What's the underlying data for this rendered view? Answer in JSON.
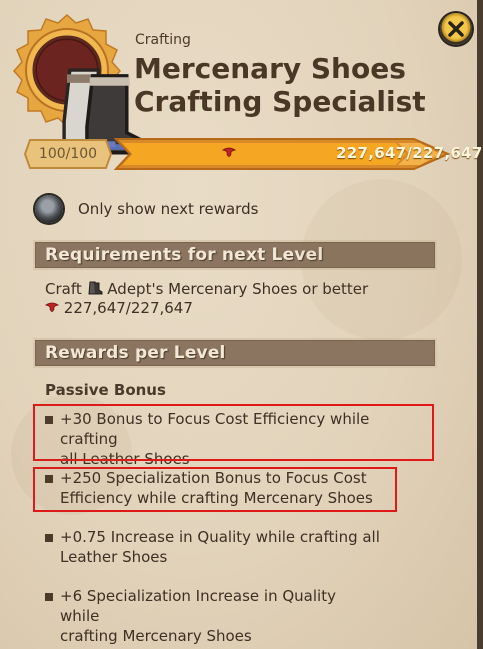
{
  "header": {
    "subtitle": "Crafting",
    "title_line1": "Mercenary Shoes",
    "title_line2": "Crafting Specialist"
  },
  "icons": {
    "item": "mercenary-shoes-icon",
    "close": "close-icon",
    "fame": "fame-icon",
    "toggle": "toggle-icon"
  },
  "progress": {
    "level": "100/100",
    "fame_text": "227,647/227,647",
    "fraction": 1.0
  },
  "toggle": {
    "label": "Only show next rewards"
  },
  "requirements": {
    "heading": "Requirements for next Level",
    "craft_prefix": "Craft",
    "craft_item": "Adept's Mercenary Shoes or better",
    "fame": "227,647/227,647"
  },
  "rewards": {
    "heading": "Rewards per Level",
    "passive_title": "Passive Bonus",
    "bonuses": [
      {
        "line1": "+30 Bonus to Focus Cost Efficiency while crafting",
        "line2": "all Leather Shoes"
      },
      {
        "line1": "+250 Specialization Bonus to Focus Cost",
        "line2": "Efficiency while crafting Mercenary Shoes"
      },
      {
        "line1": "+0.75 Increase in Quality while crafting all",
        "line2": "Leather Shoes"
      },
      {
        "line1": "+6 Specialization Increase in Quality while",
        "line2": "crafting Mercenary Shoes"
      }
    ]
  },
  "colors": {
    "highlight": "#e01818",
    "bar_fill": "#f5a623",
    "header_bar": "#8b7560"
  }
}
